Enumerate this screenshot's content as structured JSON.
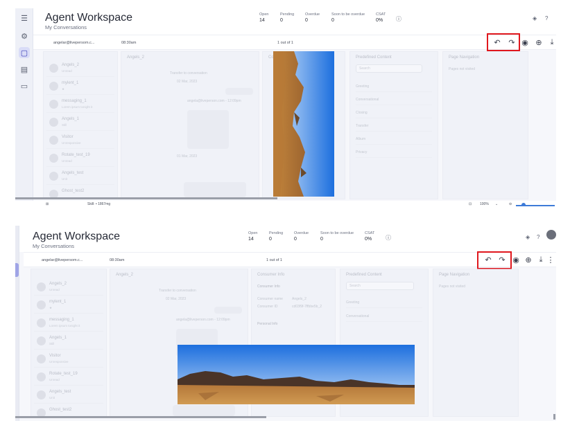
{
  "app": {
    "title": "Agent Workspace",
    "subtitle": "My Conversations"
  },
  "stats": [
    {
      "label": "Open",
      "value": "14"
    },
    {
      "label": "Pending",
      "value": "0"
    },
    {
      "label": "Overdue",
      "value": "0"
    },
    {
      "label": "Soon to be overdue",
      "value": "0"
    },
    {
      "label": "CSAT",
      "value": "0%"
    }
  ],
  "toolbar": {
    "email": "angelar@livepersom.c...",
    "time": "08:30am",
    "pager": "1 out of 1",
    "icons": [
      "undo-icon",
      "redo-icon",
      "eye-icon",
      "zoom-in-icon",
      "download-icon"
    ]
  },
  "conversations": [
    {
      "name": "Angels_2",
      "preview": "Unread"
    },
    {
      "name": "mylent_1",
      "preview": "★"
    },
    {
      "name": "messaging_1",
      "preview": "Lorem ipsum tonight it"
    },
    {
      "name": "Angels_1",
      "preview": "Still"
    },
    {
      "name": "Visitor",
      "preview": "Unresponsive"
    },
    {
      "name": "Rotate_test_19",
      "preview": "Unread"
    },
    {
      "name": "Angels_test",
      "preview": "Unit"
    },
    {
      "name": "Ghost_test2",
      "preview": ""
    }
  ],
  "chat": {
    "header": "Angels_2",
    "system_msg": "Transfer to conversation",
    "date1": "02 Mar, 2023",
    "date2": "01 Mar, 2023",
    "sender": "angela@liveperson.com - 12:09pm"
  },
  "consumer_info": {
    "title": "Consumer Info",
    "section1": "Consumer Info",
    "consumer_name_label": "Consumer name",
    "consumer_name": "Angels_2",
    "consumer_id_label": "Consumer ID",
    "consumer_id": "cd03f9f-7ffbbe5b_2",
    "section2": "Personal Info"
  },
  "predefined": {
    "title": "Predefined Content",
    "search_placeholder": "Search",
    "items": [
      "Greeting",
      "Conversational",
      "Closing",
      "Transfer",
      "Album",
      "Privacy"
    ]
  },
  "page_navigation": {
    "title": "Page Navigation",
    "value": "Pages not visited"
  },
  "statusbar": {
    "dims": "Skill: • 1867mg",
    "zoom": "100%"
  },
  "photos": {
    "top": "rotated desert landscape photo",
    "bottom": "desert landscape photo"
  },
  "colors": {
    "highlight": "#e0171d",
    "accent": "#3c3fb8",
    "zoom": "#3d7bd8"
  }
}
